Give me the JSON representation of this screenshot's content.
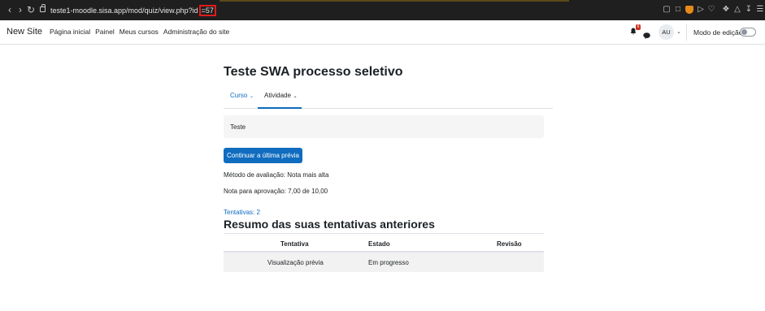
{
  "browser": {
    "url_prefix": "teste1-moodle.sisa.app/mod/quiz/view.php?id",
    "url_highlight": "=57"
  },
  "navbar": {
    "site_name": "New Site",
    "menu": [
      "Página inicial",
      "Painel",
      "Meus cursos",
      "Administração do site"
    ],
    "notification_count": "6",
    "avatar_initials": "AU",
    "edit_mode_label": "Modo de edição",
    "edit_mode_on": false
  },
  "page": {
    "title": "Teste SWA processo seletivo",
    "tabs": [
      {
        "label": "Curso",
        "active": false
      },
      {
        "label": "Atividade",
        "active": true
      }
    ],
    "intro": "Teste",
    "continue_button": "Continuar a última prévia",
    "grading_method": "Método de avaliação: Nota mais alta",
    "passing_grade": "Nota para aprovação: 7,00 de 10,00",
    "attempts_link": "Tentativas: 2",
    "summary_title": "Resumo das suas tentativas anteriores",
    "table": {
      "headers": [
        "Tentativa",
        "Estado",
        "Revisão"
      ],
      "rows": [
        [
          "Visualização prévia",
          "Em progresso",
          ""
        ]
      ]
    }
  },
  "colors": {
    "primary": "#0f6cbf",
    "chrome_bg": "#1f1f1f",
    "highlight_box": "#e11b1b",
    "badge": "#ca3120"
  }
}
